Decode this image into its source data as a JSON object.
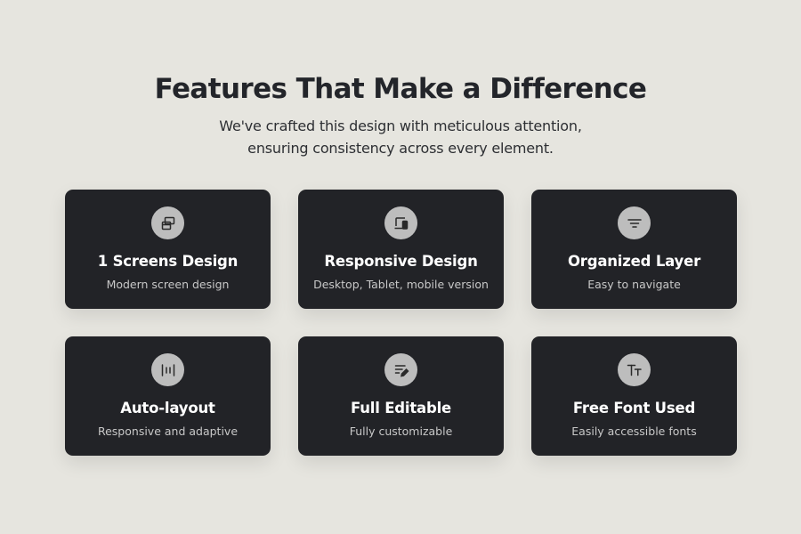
{
  "header": {
    "title": "Features That Make a Difference",
    "subtitle_line1": "We've crafted this design with meticulous attention,",
    "subtitle_line2": "ensuring consistency across every element."
  },
  "colors": {
    "background": "#e6e5df",
    "card": "#222327",
    "icon_circle": "#bdbdbd"
  },
  "features": [
    {
      "title": "1 Screens Design",
      "description": "Modern screen design",
      "icon": "screens-icon"
    },
    {
      "title": "Responsive Design",
      "description": "Desktop, Tablet, mobile version",
      "icon": "devices-icon"
    },
    {
      "title": "Organized Layer",
      "description": "Easy to navigate",
      "icon": "filter-icon"
    },
    {
      "title": "Auto-layout",
      "description": "Responsive and adaptive",
      "icon": "auto-layout-icon"
    },
    {
      "title": "Full Editable",
      "description": "Fully customizable",
      "icon": "edit-icon"
    },
    {
      "title": "Free Font Used",
      "description": "Easily accessible fonts",
      "icon": "font-icon"
    }
  ]
}
